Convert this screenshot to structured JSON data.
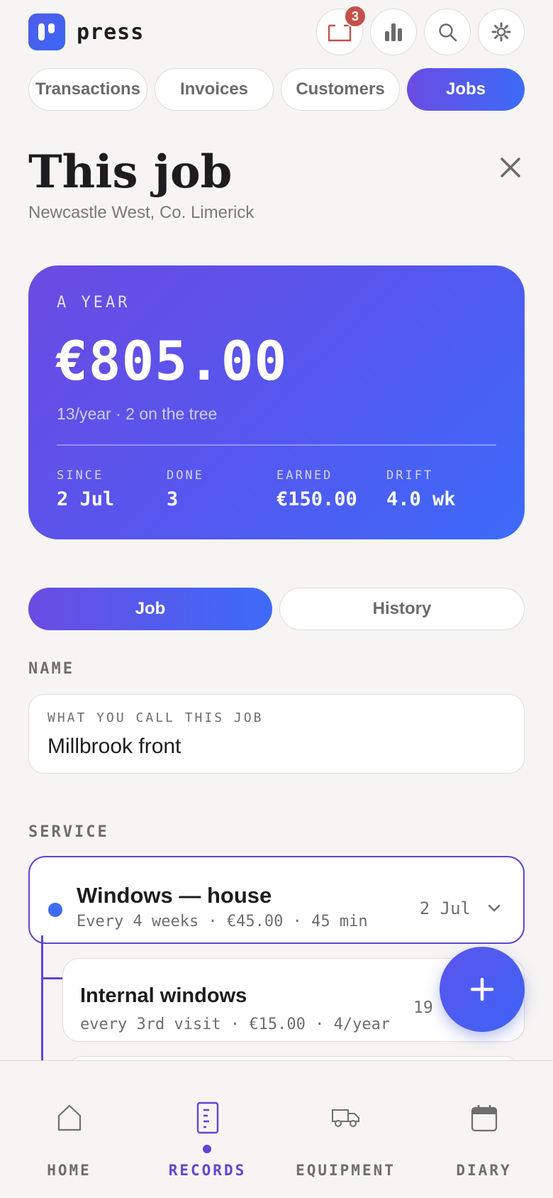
{
  "header": {
    "brand": "press",
    "notifications_count": "3"
  },
  "nav": {
    "tabs": [
      {
        "label": "Transactions",
        "active": false
      },
      {
        "label": "Invoices",
        "active": false
      },
      {
        "label": "Customers",
        "active": false
      },
      {
        "label": "Jobs",
        "active": true
      }
    ]
  },
  "page": {
    "title": "This job",
    "location": "Newcastle West, Co. Limerick"
  },
  "summary": {
    "period_label": "A YEAR",
    "amount": "€805.00",
    "sub": "13/year · 2 on the tree",
    "stats": [
      {
        "key": "SINCE",
        "value": "2 Jul"
      },
      {
        "key": "DONE",
        "value": "3"
      },
      {
        "key": "EARNED",
        "value": "€150.00"
      },
      {
        "key": "DRIFT",
        "value": "4.0 wk"
      }
    ]
  },
  "toggle": {
    "job": "Job",
    "history": "History",
    "active": "Job"
  },
  "name_section": {
    "label": "NAME",
    "field_caption": "WHAT YOU CALL THIS JOB",
    "field_value": "Millbrook front"
  },
  "service_section": {
    "label": "SERVICE",
    "main": {
      "title": "Windows — house",
      "meta": "Every 4 weeks · €45.00 · 45 min",
      "date": "2 Jul"
    },
    "children": [
      {
        "title": "Internal windows",
        "meta": "every 3rd visit · €15.00 · 4/year",
        "date": "19 ..."
      }
    ]
  },
  "bottom_nav": {
    "items": [
      {
        "label": "HOME",
        "icon": "home-icon",
        "active": false
      },
      {
        "label": "RECORDS",
        "icon": "records-icon",
        "active": true
      },
      {
        "label": "EQUIPMENT",
        "icon": "truck-icon",
        "active": false
      },
      {
        "label": "DIARY",
        "icon": "calendar-icon",
        "active": false
      }
    ]
  },
  "colors": {
    "accent_purple": "#6244d6",
    "accent_blue": "#3d6bf8",
    "badge_red": "#c4504a",
    "background": "#f6f5f3"
  }
}
